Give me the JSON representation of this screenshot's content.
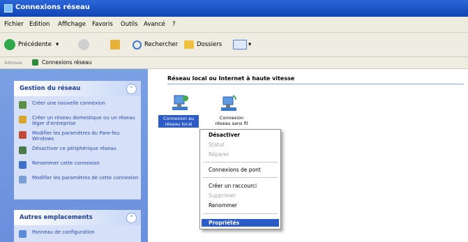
{
  "window": {
    "title": "Connexions réseau"
  },
  "menubar": {
    "items": [
      "Fichier",
      "Edition",
      "Affichage",
      "Favoris",
      "Outils",
      "Avancé",
      "?"
    ]
  },
  "toolbar": {
    "back": "Précédente",
    "search": "Rechercher",
    "folders": "Dossiers"
  },
  "address": {
    "label": "Adresse",
    "value": "Connexions réseau"
  },
  "sidebar": {
    "panel1": {
      "title": "Gestion du réseau",
      "tasks": [
        "Créer une nouvelle connexion",
        "Créer un réseau domestique ou un réseau léger d'entreprise",
        "Modifier les paramètres du Pare-feu Windows",
        "Désactiver ce périphérique réseau",
        "Renommer cette connexion",
        "Modifier les paramètres de cette connexion"
      ]
    },
    "panel2": {
      "title": "Autres emplacements",
      "tasks": [
        "Panneau de configuration"
      ]
    }
  },
  "content": {
    "heading": "Réseau local ou Internet à haute vitesse",
    "items": [
      {
        "label_lines": [
          "Connexion au",
          "réseau local"
        ],
        "selected": true
      },
      {
        "label_lines": [
          "Connexion",
          "réseau sans fil"
        ],
        "selected": false
      }
    ]
  },
  "context_menu": {
    "items": [
      {
        "label": "Désactiver",
        "enabled": true
      },
      {
        "label": "Statut",
        "enabled": false
      },
      {
        "label": "Réparer",
        "enabled": false
      },
      {
        "label": "Connexions de pont",
        "enabled": true
      },
      {
        "label": "Créer un raccourci",
        "enabled": true
      },
      {
        "label": "Supprimer",
        "enabled": false
      },
      {
        "label": "Renommer",
        "enabled": true
      },
      {
        "label": "Propriétés",
        "enabled": true,
        "highlighted": true
      }
    ]
  },
  "colors": {
    "titlebar": "#1f55c9",
    "sidebar_bg": "#7ba0e4",
    "panel_bg": "#d6e0f8",
    "link": "#284bb3",
    "highlight": "#2a5bc7"
  }
}
